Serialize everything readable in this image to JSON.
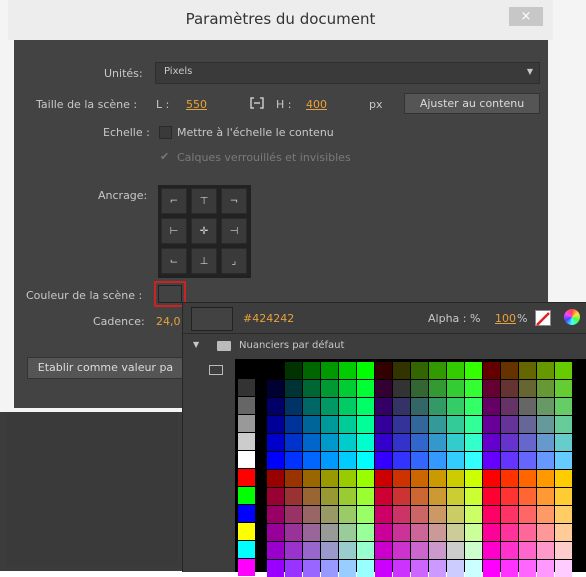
{
  "dialog": {
    "title": "Paramètres du document",
    "close_glyph": "×",
    "units_label": "Unités:",
    "units_value": "Pixels",
    "stage_size_label": "Taille de la scène :",
    "width_label": "L :",
    "width_value": "550",
    "height_label": "H :",
    "height_value": "400",
    "px_label": "px",
    "fit_button": "Ajuster au contenu",
    "scale_label": "Echelle :",
    "scale_checkbox": "Mettre à l'échelle le contenu",
    "locked_layers": "Calques verrouillés et invisibles",
    "anchor_label": "Ancrage:",
    "stage_color_label": "Couleur de la scène :",
    "framerate_label": "Cadence:",
    "framerate_value": "24,0",
    "set_default_button": "Etablir comme valeur pa"
  },
  "picker": {
    "hex_value": "#424242",
    "alpha_label": "Alpha : %",
    "alpha_value": "100",
    "alpha_pct": "%",
    "folder_label": "Nuanciers par défaut",
    "accent_color": "#e8a23a"
  }
}
